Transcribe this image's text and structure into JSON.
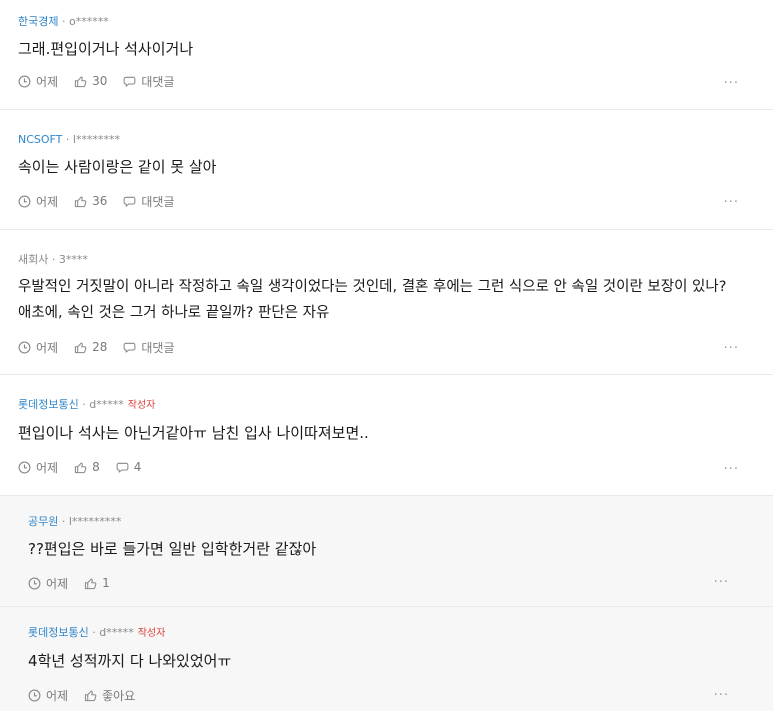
{
  "comments": [
    {
      "company": "한국경제",
      "sep": " · ",
      "user": "o******",
      "writer": "",
      "text": "그래.편입이거나 석사이거나",
      "time": "어제",
      "likes": "30",
      "reply": "대댓글",
      "more": "···"
    },
    {
      "company": "NCSOFT",
      "sep": " · ",
      "user": "l********",
      "writer": "",
      "text": "속이는 사람이랑은 같이 못 살아",
      "time": "어제",
      "likes": "36",
      "reply": "대댓글",
      "more": "···"
    },
    {
      "company": "새회사",
      "sep": " · ",
      "user": "3****",
      "writer": "",
      "text": "우발적인 거짓말이 아니라 작정하고 속일 생각이었다는 것인데, 결혼 후에는 그런 식으로 안 속일 것이란 보장이 있나? 애초에, 속인 것은 그거 하나로 끝일까? 판단은 자유",
      "time": "어제",
      "likes": "28",
      "reply": "대댓글",
      "more": "···"
    },
    {
      "company": "롯데정보통신",
      "sep": " · ",
      "user": "d*****",
      "writer": "작성자",
      "text": "편입이나 석사는 아닌거같아ㅠ 남친 입사 나이따져보면..",
      "time": "어제",
      "likes": "8",
      "reply": "4",
      "more": "···"
    },
    {
      "company": "공무원",
      "sep": " · ",
      "user": "l*********",
      "writer": "",
      "text": "??편입은 바로 들가면 일반 입학한거란 같잖아",
      "time": "어제",
      "likes": "1",
      "reply": "",
      "more": "···"
    },
    {
      "company": "롯데정보통신",
      "sep": " · ",
      "user": "d*****",
      "writer": "작성자",
      "text": "4학년 성적까지 다 나와있었어ㅠ",
      "time": "어제",
      "likes": "좋아요",
      "reply": "",
      "more": "···"
    }
  ]
}
